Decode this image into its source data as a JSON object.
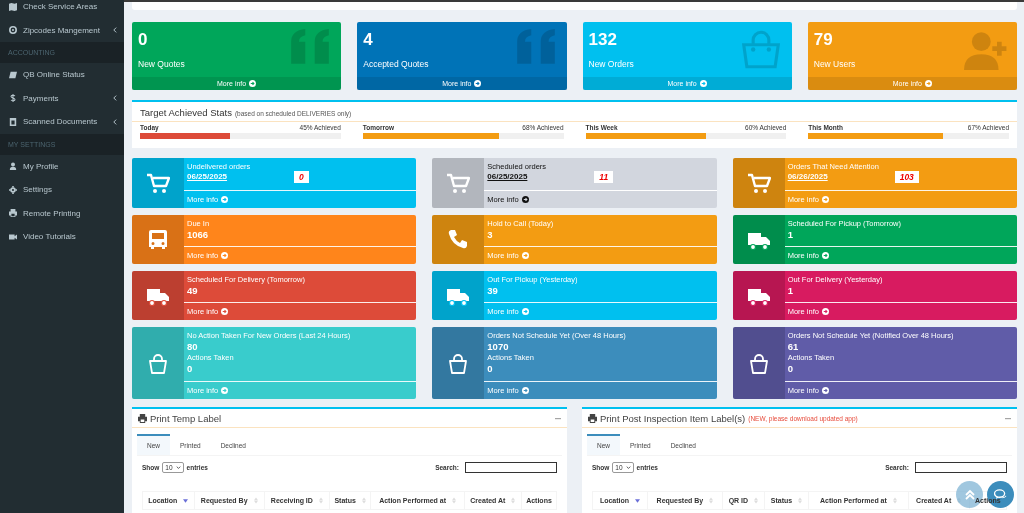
{
  "sidebar": {
    "items": [
      {
        "kind": "item",
        "label": "Check Service Areas",
        "has_submenu": false
      },
      {
        "kind": "item",
        "label": "Zipcodes Mangement",
        "has_submenu": true
      },
      {
        "kind": "header",
        "label": "ACCOUNTING"
      },
      {
        "kind": "item",
        "label": "QB Online Status",
        "has_submenu": false
      },
      {
        "kind": "item",
        "label": "Payments",
        "has_submenu": true
      },
      {
        "kind": "item",
        "label": "Scanned Documents",
        "has_submenu": true
      },
      {
        "kind": "header",
        "label": "MY SETTINGS"
      },
      {
        "kind": "item",
        "label": "My Profile",
        "has_submenu": false
      },
      {
        "kind": "item",
        "label": "Settings",
        "has_submenu": false
      },
      {
        "kind": "item",
        "label": "Remote Printing",
        "has_submenu": false
      },
      {
        "kind": "item",
        "label": "Video Tutorials",
        "has_submenu": false
      }
    ]
  },
  "stat_boxes": [
    {
      "value": "0",
      "label": "New Quotes",
      "link": "More info",
      "color": "#00a65a"
    },
    {
      "value": "4",
      "label": "Accepted Quotes",
      "link": "More info",
      "color": "#0073b7"
    },
    {
      "value": "132",
      "label": "New Orders",
      "link": "More info",
      "color": "#00c0ef"
    },
    {
      "value": "79",
      "label": "New Users",
      "link": "More info",
      "color": "#f39c12"
    }
  ],
  "target_stats": {
    "title": "Target Achieved Stats",
    "note": "(based on scheduled DELIVERIES only)",
    "items": [
      {
        "label": "Today",
        "reading": "45% Achieved",
        "level": 0.45,
        "color": "#dd4b39"
      },
      {
        "label": "Tomorrow",
        "reading": "68% Achieved",
        "level": 0.68,
        "color": "#f39c12"
      },
      {
        "label": "This Week",
        "reading": "60% Achieved",
        "level": 0.6,
        "color": "#f39c12"
      },
      {
        "label": "This Month",
        "reading": "67% Achieved",
        "level": 0.67,
        "color": "#f39c12"
      }
    ]
  },
  "info_boxes": [
    {
      "kind": "date",
      "title": "Undelivered orders",
      "date": "06/25/2025",
      "badge": "0",
      "link": "More info",
      "color": "#00c0ef"
    },
    {
      "kind": "date",
      "title": "Scheduled orders",
      "date": "06/25/2025",
      "badge": "11",
      "link": "More info",
      "color": "#d2d6de"
    },
    {
      "kind": "date",
      "title": "Orders That Need Attention",
      "date": "06/26/2025",
      "badge": "103",
      "link": "More info",
      "color": "#f39c12"
    },
    {
      "kind": "count",
      "title": "Due In",
      "value": "1066",
      "link": "More info",
      "color": "#ff851b"
    },
    {
      "kind": "count",
      "title": "Hold to Call (Today)",
      "value": "3",
      "link": "More info",
      "color": "#f39c12"
    },
    {
      "kind": "count",
      "title": "Scheduled For Pickup (Tomorrow)",
      "value": "1",
      "link": "More info",
      "color": "#00a65a"
    },
    {
      "kind": "count",
      "title": "Scheduled For Delivery (Tomorrow)",
      "value": "49",
      "link": "More info",
      "color": "#dd4b39"
    },
    {
      "kind": "count",
      "title": "Out For Pickup (Yesterday)",
      "value": "39",
      "link": "More info",
      "color": "#00c0ef"
    },
    {
      "kind": "count",
      "title": "Out For Delivery (Yesterday)",
      "value": "1",
      "link": "More info",
      "color": "#d81b60"
    },
    {
      "kind": "actions",
      "title": "No Action Taken For New Orders (Last 24 Hours)",
      "value": "80",
      "sub_label": "Actions Taken",
      "sub_value": "0",
      "link": "More info",
      "color": "#39cccc"
    },
    {
      "kind": "actions",
      "title": "Orders Not Schedule Yet (Over 48 Hours)",
      "value": "1070",
      "sub_label": "Actions Taken",
      "sub_value": "0",
      "link": "More info",
      "color": "#3c8dbc"
    },
    {
      "kind": "actions",
      "title": "Orders Not Schedule Yet (Notified Over 48 Hours)",
      "value": "61",
      "sub_label": "Actions Taken",
      "sub_value": "0",
      "link": "More info",
      "color": "#605ca8"
    }
  ],
  "panels": [
    {
      "title": "Print Temp Label",
      "tabs": [
        {
          "label": "New",
          "selected": true
        },
        {
          "label": "Printed",
          "selected": false
        },
        {
          "label": "Declined",
          "selected": false
        }
      ],
      "show_label": "Show",
      "page_size": "10",
      "entries_label": "entries",
      "search_label": "Search:",
      "columns": [
        {
          "label": "Location",
          "sortable": true,
          "sorted": true
        },
        {
          "label": "Requested By",
          "sortable": true,
          "sorted": false
        },
        {
          "label": "Receiving ID",
          "sortable": true,
          "sorted": false
        },
        {
          "label": "Status",
          "sortable": true,
          "sorted": false
        },
        {
          "label": "Action Performed at",
          "sortable": true,
          "sorted": false
        },
        {
          "label": "Created At",
          "sortable": true,
          "sorted": false
        },
        {
          "label": "Actions",
          "sortable": false
        }
      ]
    },
    {
      "title": "Print Post Inspection Item Label(s)",
      "note": "(NEW, please download updated app)",
      "tabs": [
        {
          "label": "New",
          "selected": true
        },
        {
          "label": "Printed",
          "selected": false
        },
        {
          "label": "Declined",
          "selected": false
        }
      ],
      "show_label": "Show",
      "page_size": "10",
      "entries_label": "entries",
      "search_label": "Search:",
      "columns": [
        {
          "label": "Location",
          "sortable": true,
          "sorted": true
        },
        {
          "label": "Requested By",
          "sortable": true,
          "sorted": false
        },
        {
          "label": "QR ID",
          "sortable": true,
          "sorted": false
        },
        {
          "label": "Status",
          "sortable": true,
          "sorted": false
        },
        {
          "label": "Action Performed at",
          "sortable": true,
          "sorted": false
        },
        {
          "label": "Created At",
          "sortable": true,
          "sorted": false
        },
        {
          "label": "Actions",
          "sortable": false
        }
      ]
    }
  ]
}
